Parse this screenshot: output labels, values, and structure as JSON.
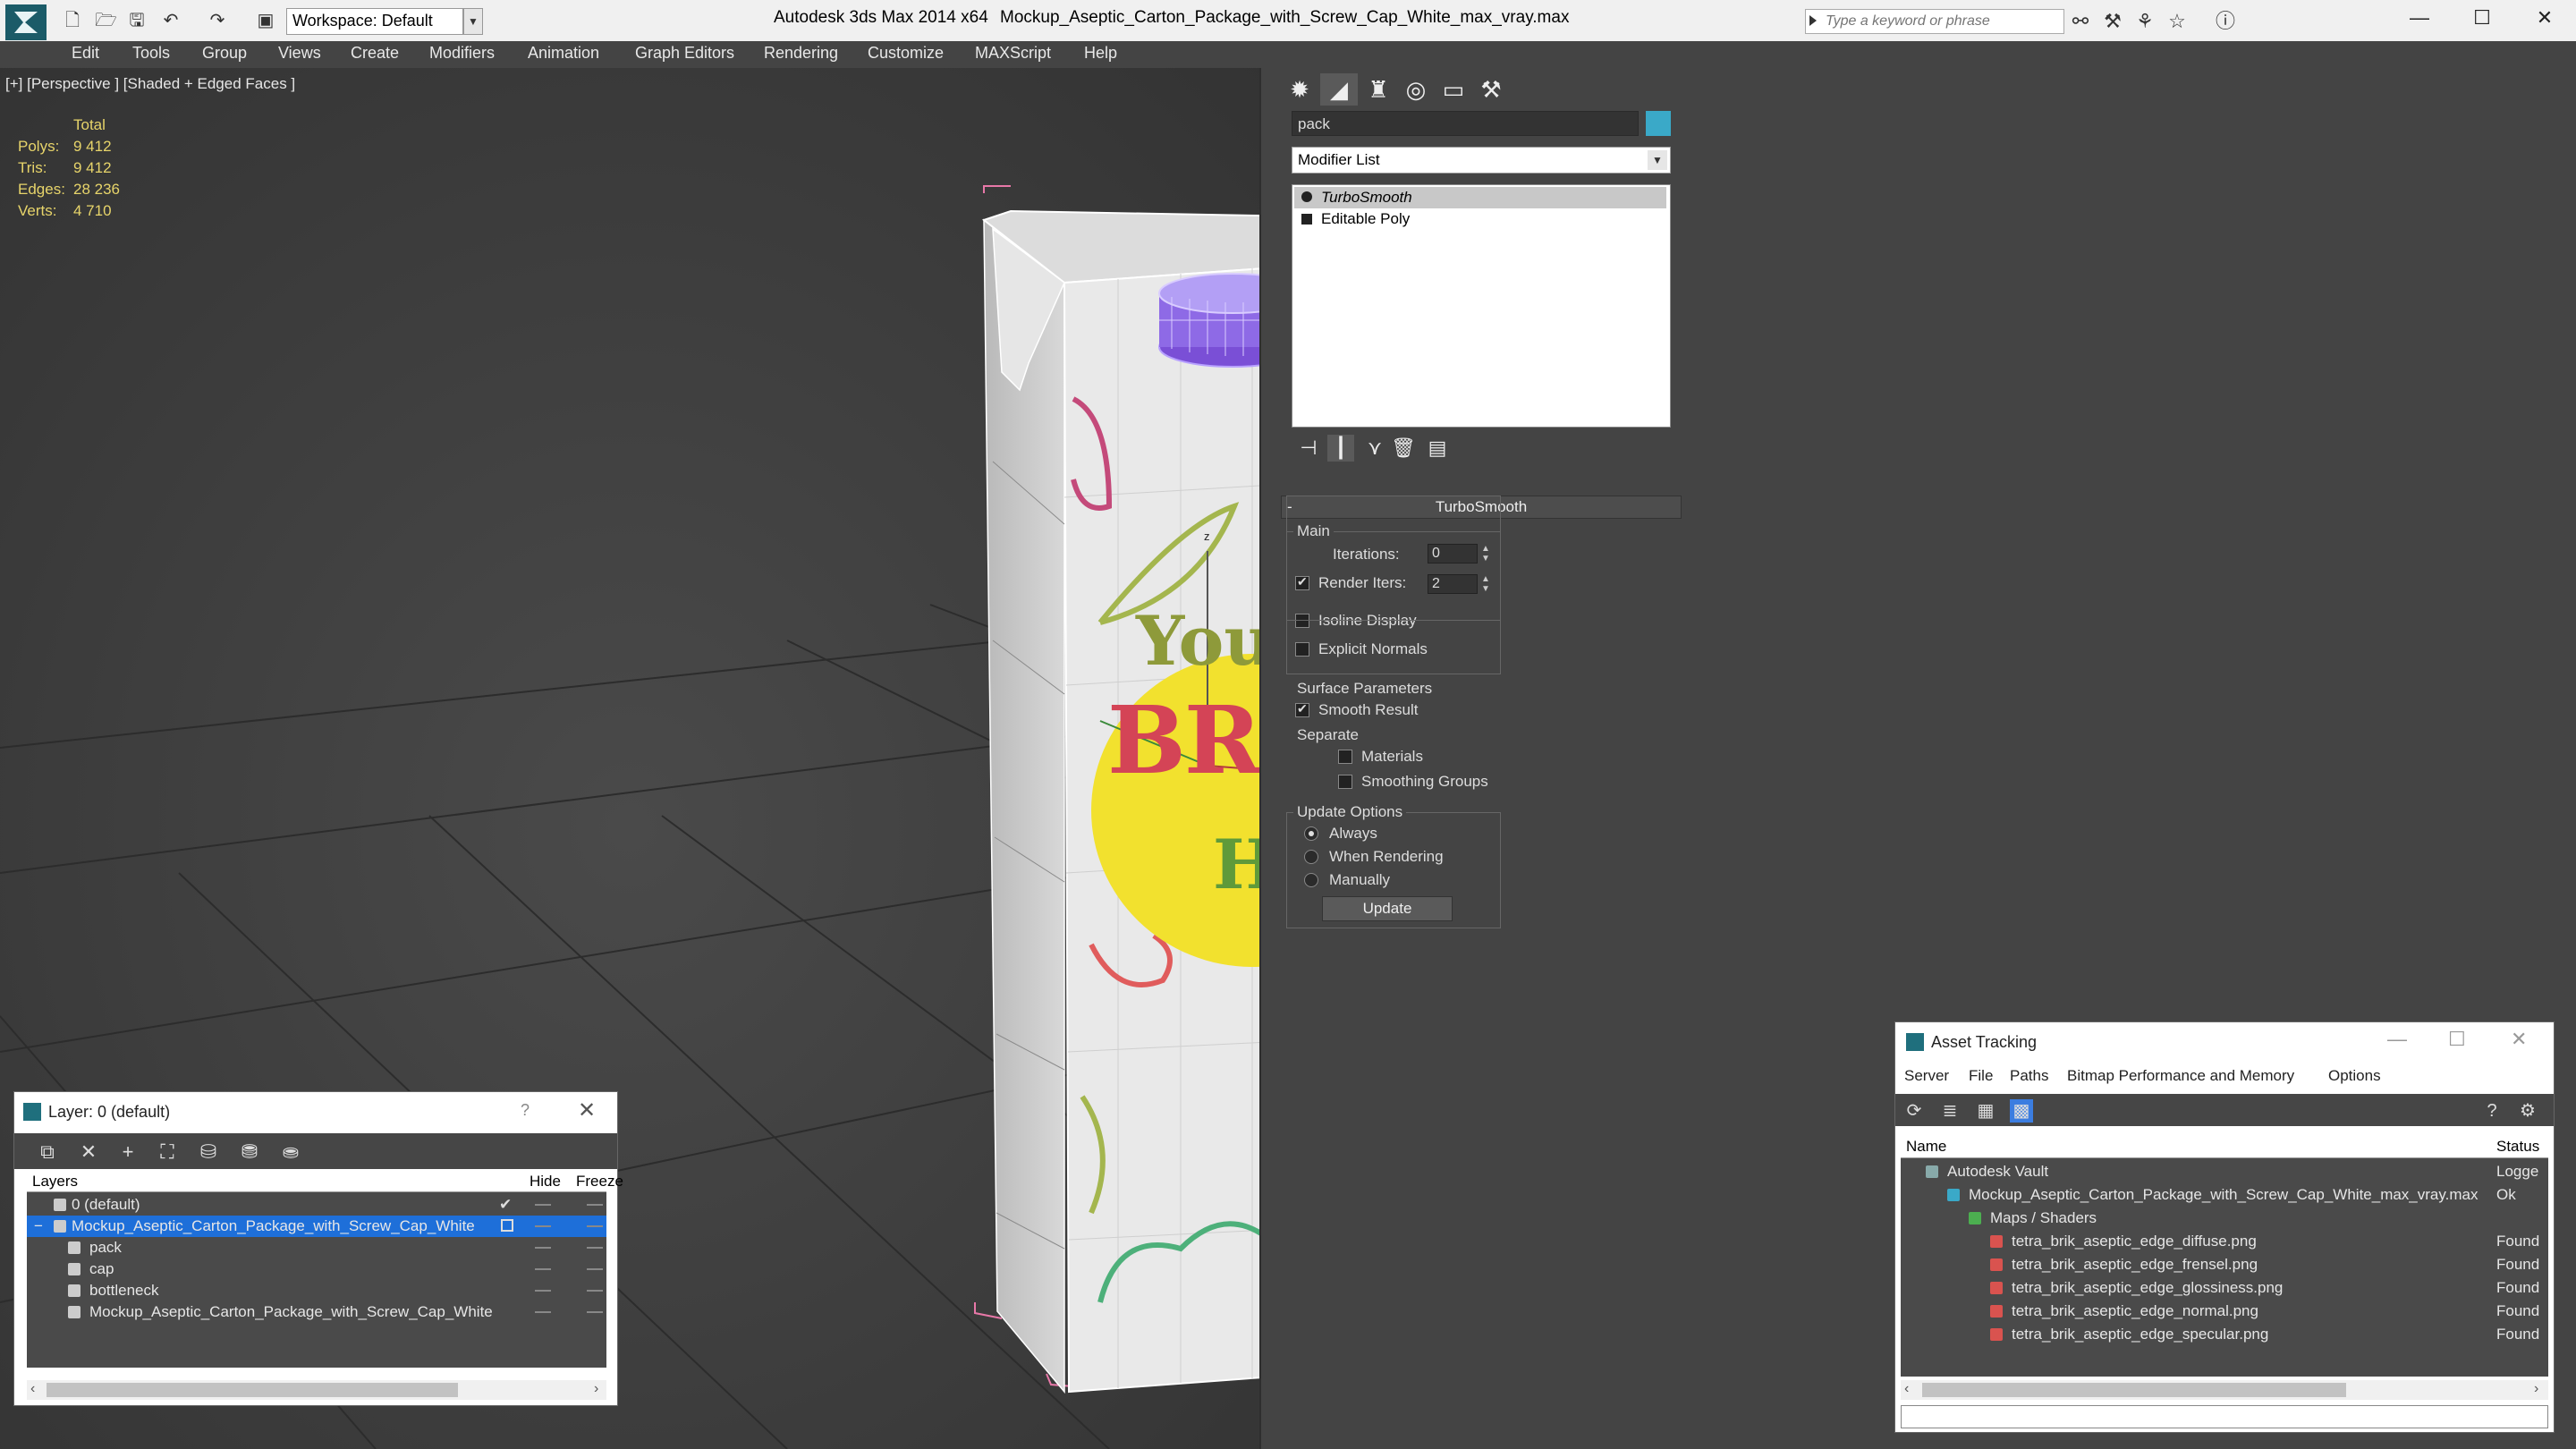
{
  "titlebar": {
    "workspace": "Workspace: Default",
    "app_title": "Autodesk 3ds Max 2014 x64",
    "file_title": "Mockup_Aseptic_Carton_Package_with_Screw_Cap_White_max_vray.max",
    "search_placeholder": "Type a keyword or phrase",
    "window_buttons": {
      "minimize": "—",
      "maximize": "☐",
      "close": "✕"
    }
  },
  "menubar": [
    "Edit",
    "Tools",
    "Group",
    "Views",
    "Create",
    "Modifiers",
    "Animation",
    "Graph Editors",
    "Rendering",
    "Customize",
    "MAXScript",
    "Help"
  ],
  "viewport": {
    "label": "[+] [Perspective ] [Shaded + Edged Faces ]",
    "stats": {
      "header": "Total",
      "rows": [
        {
          "label": "Polys:",
          "value": "9 412"
        },
        {
          "label": "Tris:",
          "value": "9 412"
        },
        {
          "label": "Edges:",
          "value": "28 236"
        },
        {
          "label": "Verts:",
          "value": "4 710"
        }
      ]
    },
    "carton": {
      "line1": "Your",
      "line2": "BRAND",
      "line3": "Here"
    },
    "gizmo_label": "z"
  },
  "command_panel": {
    "object_name": "pack",
    "object_color": "#3aa9c8",
    "modifier_list": "Modifier List",
    "stack": [
      "TurboSmooth",
      "Editable Poly"
    ],
    "turbosmooth": {
      "title": "TurboSmooth",
      "main": "Main",
      "iterations_label": "Iterations:",
      "iterations_value": "0",
      "render_iters_label": "Render Iters:",
      "render_iters_value": "2",
      "isoline": "Isoline Display",
      "explicit": "Explicit Normals",
      "surface": "Surface Parameters",
      "smooth_result": "Smooth Result",
      "separate": "Separate",
      "materials": "Materials",
      "smoothing_groups": "Smoothing Groups",
      "update_options": "Update Options",
      "always": "Always",
      "when_rendering": "When Rendering",
      "manually": "Manually",
      "update_btn": "Update"
    }
  },
  "layer_dialog": {
    "title": "Layer: 0 (default)",
    "help": "?",
    "close": "✕",
    "headers": {
      "layers": "Layers",
      "hide": "Hide",
      "freeze": "Freeze"
    },
    "rows": [
      "0 (default)",
      "Mockup_Aseptic_Carton_Package_with_Screw_Cap_White",
      "pack",
      "cap",
      "bottleneck",
      "Mockup_Aseptic_Carton_Package_with_Screw_Cap_White"
    ]
  },
  "asset_dialog": {
    "title": "Asset Tracking",
    "menu": [
      "Server",
      "File",
      "Paths",
      "Bitmap Performance and Memory",
      "Options"
    ],
    "headers": {
      "name": "Name",
      "status": "Status"
    },
    "rows": [
      {
        "name": "Autodesk Vault",
        "status": "Logge"
      },
      {
        "name": "Mockup_Aseptic_Carton_Package_with_Screw_Cap_White_max_vray.max",
        "status": "Ok"
      },
      {
        "name": "Maps / Shaders",
        "status": ""
      },
      {
        "name": "tetra_brik_aseptic_edge_diffuse.png",
        "status": "Found"
      },
      {
        "name": "tetra_brik_aseptic_edge_frensel.png",
        "status": "Found"
      },
      {
        "name": "tetra_brik_aseptic_edge_glossiness.png",
        "status": "Found"
      },
      {
        "name": "tetra_brik_aseptic_edge_normal.png",
        "status": "Found"
      },
      {
        "name": "tetra_brik_aseptic_edge_specular.png",
        "status": "Found"
      }
    ]
  }
}
